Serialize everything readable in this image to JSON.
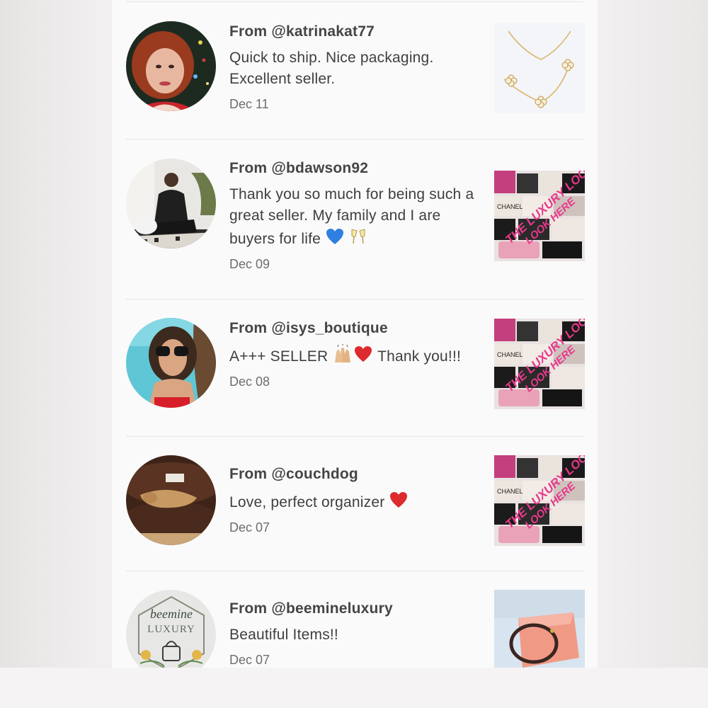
{
  "reviews": [
    {
      "from_prefix": "From ",
      "handle": "@katrinakat77",
      "message": "Quick to ship. Nice packaging. Excellent seller.",
      "emojis": [],
      "date": "Dec 11",
      "avatar": "woman-red-hair-photo",
      "thumbnail": "gold-clover-bracelet-photo"
    },
    {
      "from_prefix": "From ",
      "handle": "@bdawson92",
      "message": "Thank you so much for being such a great seller. My family and I are buyers for life",
      "emojis": [
        "blue-heart-icon",
        "champagne-glasses-icon"
      ],
      "date": "Dec 09",
      "avatar": "person-seated-photo",
      "thumbnail": "luxury-loop-bags-photo"
    },
    {
      "from_prefix": "From ",
      "handle": "@isys_boutique",
      "message_before": "A+++ SELLER ",
      "message_after": " Thank you!!!",
      "emojis": [
        "raising-hands-icon",
        "red-heart-icon"
      ],
      "date": "Dec 08",
      "avatar": "woman-sunglasses-pool-photo",
      "thumbnail": "luxury-loop-bags-photo"
    },
    {
      "from_prefix": "From ",
      "handle": "@couchdog",
      "message": "Love, perfect organizer ",
      "emojis": [
        "red-heart-icon"
      ],
      "date": "Dec 07",
      "avatar": "dog-on-couch-photo",
      "thumbnail": "luxury-loop-bags-photo"
    },
    {
      "from_prefix": "From ",
      "handle": "@beemineluxury",
      "message": "Beautiful Items!!",
      "emojis": [],
      "date": "Dec 07",
      "avatar": "beemine-luxury-logo",
      "avatar_text": [
        "beemine",
        "LUXURY"
      ],
      "thumbnail": "bracelet-pink-box-photo"
    }
  ],
  "thumbnail_overlay_text": [
    "THE LUXURY LOOP",
    "LOOK HERE"
  ],
  "thumbnail_bag_text": "CHANEL",
  "colors": {
    "panel_bg": "#fbfafa",
    "handle_text": "#454545",
    "date_text": "#6d6d6d",
    "overlay_pink": "#e8388a"
  }
}
